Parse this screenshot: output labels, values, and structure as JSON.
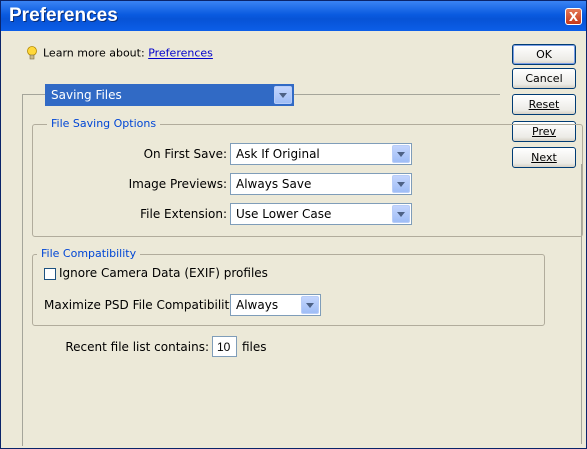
{
  "window": {
    "title": "Preferences",
    "close_label": "X"
  },
  "learn_more": {
    "prefix": "Learn more about:",
    "link": "Preferences"
  },
  "section_select": {
    "value": "Saving Files"
  },
  "buttons": {
    "ok": "OK",
    "cancel": "Cancel",
    "reset": "Reset",
    "prev": "Prev",
    "next": "Next"
  },
  "file_saving_options": {
    "legend": "File Saving Options",
    "on_first_save": {
      "label": "On First Save:",
      "value": "Ask If Original"
    },
    "image_previews": {
      "label": "Image Previews:",
      "value": "Always Save"
    },
    "file_extension": {
      "label": "File Extension:",
      "value": "Use Lower Case"
    }
  },
  "file_compatibility": {
    "legend": "File Compatibility",
    "ignore_camera_data": {
      "label": "Ignore Camera Data (EXIF) profiles",
      "checked": false
    },
    "maximize_psd": {
      "label": "Maximize PSD File Compatibility:",
      "value": "Always"
    }
  },
  "recent_files": {
    "label": "Recent file list contains:",
    "value": "10",
    "suffix": "files"
  },
  "colors": {
    "titlebar": "#0a5be0",
    "dialog_bg": "#ece9d8",
    "legend_text": "#0046d5",
    "select_highlight": "#316ac5"
  }
}
